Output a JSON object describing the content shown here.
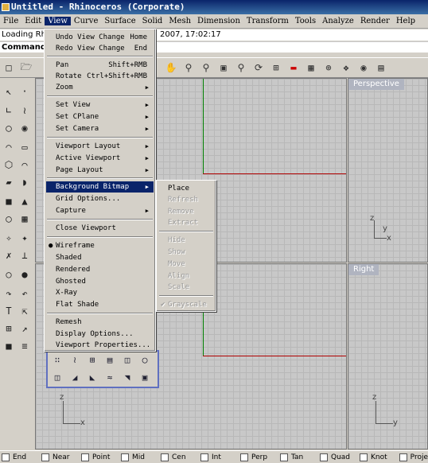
{
  "window": {
    "title": "Untitled - Rhinoceros (Corporate)"
  },
  "menubar": [
    "File",
    "Edit",
    "View",
    "Curve",
    "Surface",
    "Solid",
    "Mesh",
    "Dimension",
    "Transform",
    "Tools",
    "Analyze",
    "Render",
    "Help"
  ],
  "command": {
    "history_prefix": "Loading Rh",
    "history_suffix": "2007, 17:02:17",
    "label": "Command:"
  },
  "viewports": {
    "perspective": "Perspective",
    "right": "Right",
    "axis_x": "x",
    "axis_y": "y",
    "axis_z": "z"
  },
  "view_menu": {
    "undo": {
      "label": "Undo View Change",
      "shortcut": "Home"
    },
    "redo": {
      "label": "Redo View Change",
      "shortcut": "End"
    },
    "pan": {
      "label": "Pan",
      "shortcut": "Shift+RMB"
    },
    "rotate": {
      "label": "Rotate",
      "shortcut": "Ctrl+Shift+RMB"
    },
    "zoom": "Zoom",
    "set_view": "Set View",
    "set_cplane": "Set CPlane",
    "set_camera": "Set Camera",
    "viewport_layout": "Viewport Layout",
    "active_viewport": "Active Viewport",
    "page_layout": "Page Layout",
    "background_bitmap": "Background Bitmap",
    "grid_options": "Grid Options...",
    "capture": "Capture",
    "close_viewport": "Close Viewport",
    "wireframe": "Wireframe",
    "shaded": "Shaded",
    "rendered": "Rendered",
    "ghosted": "Ghosted",
    "xray": "X-Ray",
    "flat_shade": "Flat Shade",
    "remesh": "Remesh",
    "display_options": "Display Options...",
    "viewport_properties": "Viewport Properties..."
  },
  "bitmap_submenu": {
    "place": "Place",
    "refresh": "Refresh",
    "remove": "Remove",
    "extract": "Extract",
    "hide": "Hide",
    "show": "Show",
    "move": "Move",
    "align": "Align",
    "scale": "Scale",
    "grayscale": "Grayscale"
  },
  "osnaps": [
    "End",
    "Near",
    "Point",
    "Mid",
    "Cen",
    "Int",
    "Perp",
    "Tan",
    "Quad",
    "Knot",
    "Proje"
  ],
  "icons": {
    "toolbar": [
      "new-file-icon",
      "open-folder-icon",
      "pan-hand-icon",
      "zoom-icon",
      "zoom-window-icon",
      "zoom-extents-icon",
      "zoom-selected-icon",
      "rotate-view-icon",
      "four-viewports-icon",
      "car-icon",
      "grid-icon",
      "cplane-icon",
      "osnap-icon",
      "bulb-icon",
      "lock-icon"
    ]
  },
  "colors": {
    "title_bar": "#0a246a",
    "highlight": "#0a246a",
    "x_axis": "#b00000",
    "y_axis": "#008000",
    "viewport_title": "#b0b4c0"
  }
}
